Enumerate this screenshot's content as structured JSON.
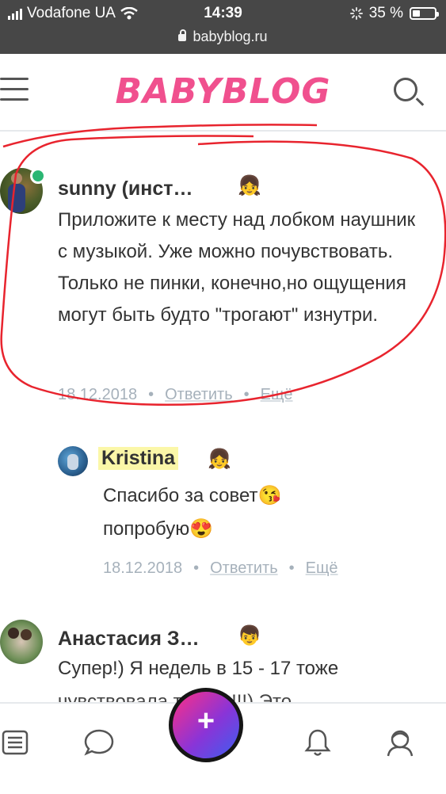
{
  "status": {
    "carrier": "Vodafone UA",
    "time": "14:39",
    "battery": "35 %",
    "battery_level": 0.35
  },
  "browser": {
    "url": "babyblog.ru"
  },
  "header": {
    "logo": "BABYBLOG"
  },
  "comments": [
    {
      "name": "sunny (инст…",
      "badge": "👧",
      "text": "Приложите к месту над лобком наушник с музыкой. Уже можно почувствовать. Только не пинки, конечно,но ощущения могут быть будто \"трогают\" изнутри.",
      "date": "18.12.2018",
      "reply": "Ответить",
      "more": "Ещё"
    },
    {
      "name": "Kristina",
      "badge": "👧",
      "text_line1": "Спасибо за совет😘",
      "text_line2": "попробую😍",
      "date": "18.12.2018",
      "reply": "Ответить",
      "more": "Ещё"
    },
    {
      "name": "Анастасия З…",
      "badge": "👦",
      "text_line1": "Супер!) Я недель в 15 - 17 тоже",
      "text_line2": "чувствовала толчки!!!) Это"
    }
  ],
  "fab": {
    "label": "+"
  }
}
